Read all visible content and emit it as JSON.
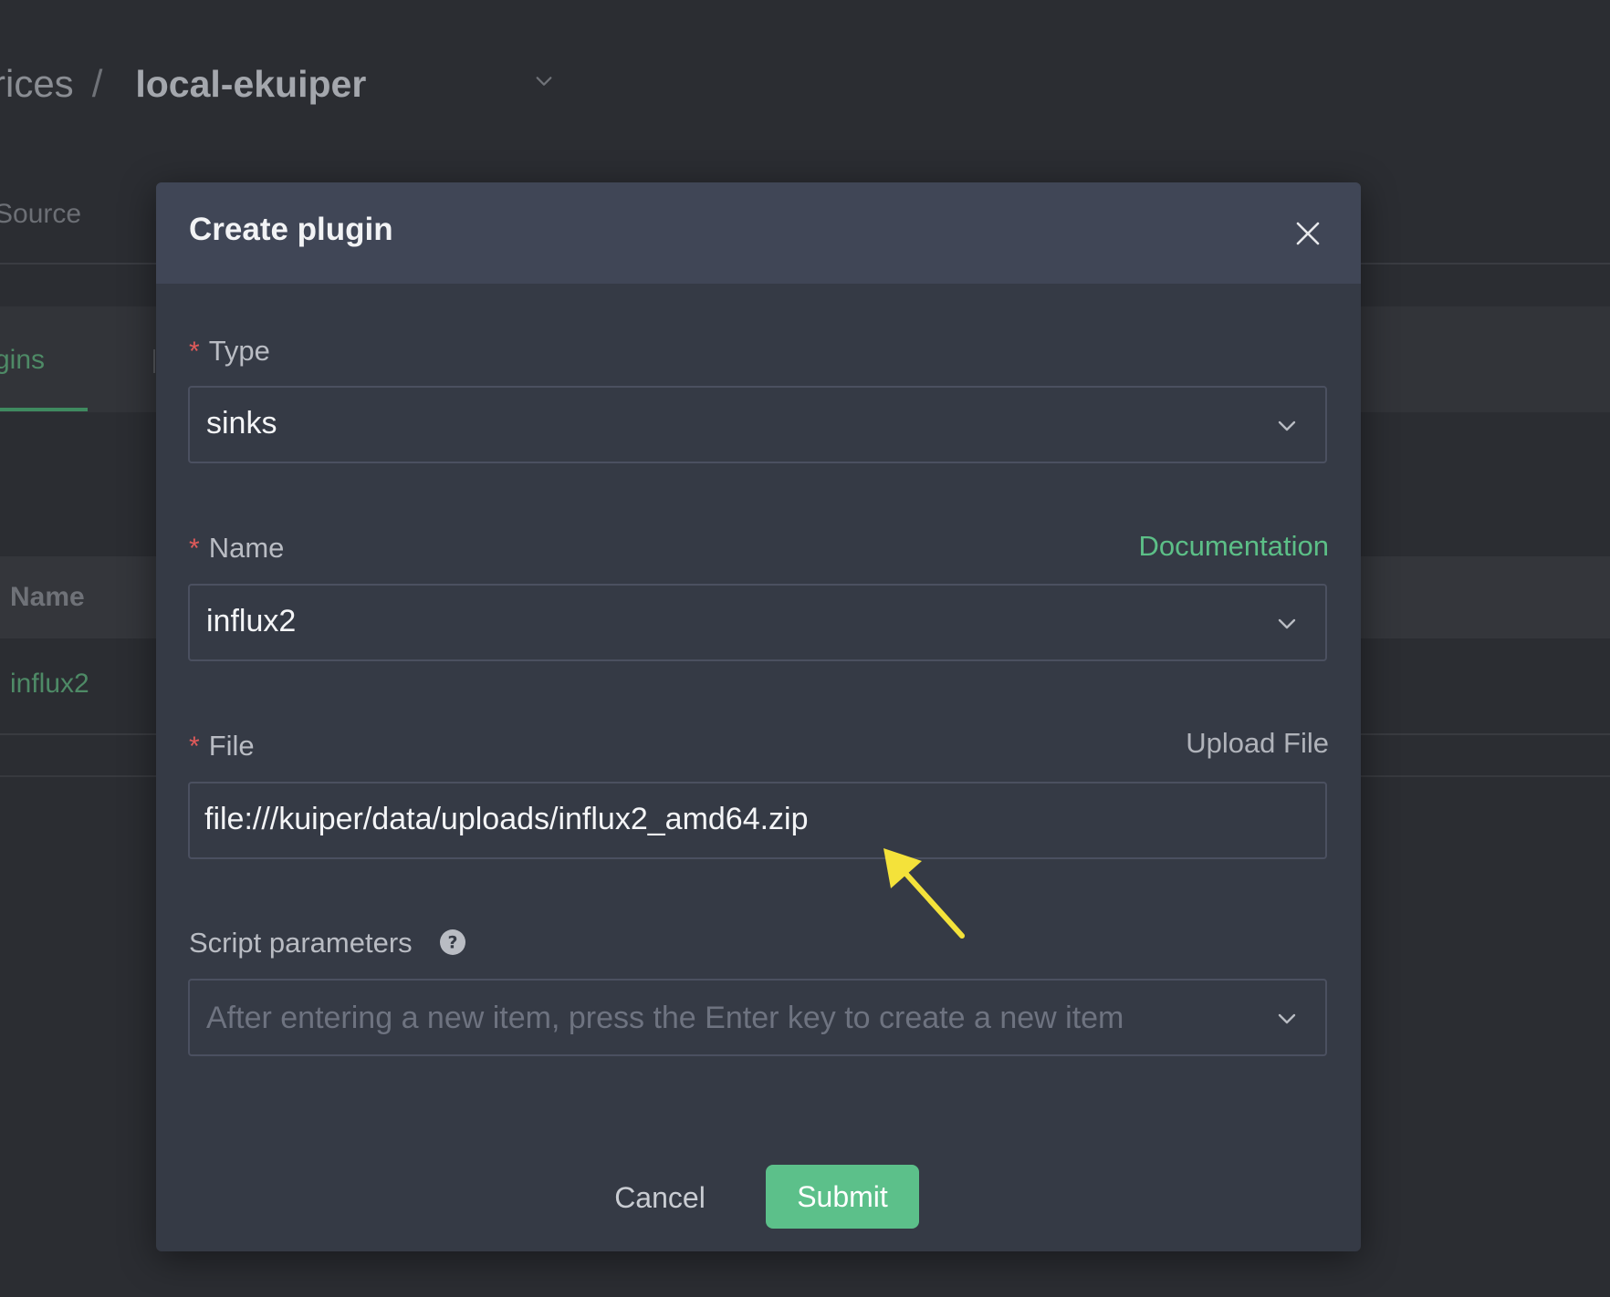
{
  "background": {
    "breadcrumb": {
      "parent_label": "rices",
      "separator": "/",
      "current_label": "local-ekuiper"
    },
    "source_tab_label": "Source",
    "plugins_tab_label": "gins",
    "table": {
      "header_name": "Name",
      "rows": [
        {
          "name": "influx2"
        }
      ]
    }
  },
  "modal": {
    "title": "Create plugin",
    "type_field": {
      "label": "Type",
      "required_mark": "*",
      "value": "sinks"
    },
    "name_field": {
      "label": "Name",
      "required_mark": "*",
      "value": "influx2",
      "link_label": "Documentation"
    },
    "file_field": {
      "label": "File",
      "required_mark": "*",
      "value": "file:///kuiper/data/uploads/influx2_amd64.zip",
      "link_label": "Upload File"
    },
    "script_params_field": {
      "label": "Script parameters",
      "placeholder": "After entering a new item, press the Enter key to create a new item"
    },
    "cancel_label": "Cancel",
    "submit_label": "Submit"
  },
  "colors": {
    "accent_green": "#5cc08a",
    "required_red": "#e05a5a",
    "annotation_arrow": "#f4e23a"
  },
  "icons": {
    "close": "close-icon",
    "select": "chevron-down-icon",
    "help": "question-circle-icon",
    "annotation": "arrow-icon"
  }
}
